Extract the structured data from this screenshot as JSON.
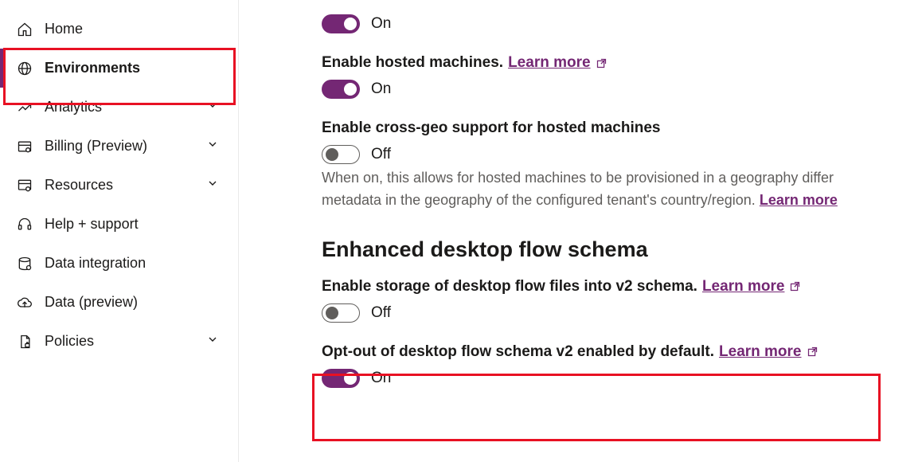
{
  "sidebar": {
    "items": [
      {
        "label": "Home"
      },
      {
        "label": "Environments"
      },
      {
        "label": "Analytics"
      },
      {
        "label": "Billing (Preview)"
      },
      {
        "label": "Resources"
      },
      {
        "label": "Help + support"
      },
      {
        "label": "Data integration"
      },
      {
        "label": "Data (preview)"
      },
      {
        "label": "Policies"
      }
    ]
  },
  "main": {
    "toggle_on": "On",
    "toggle_off": "Off",
    "learn_more": "Learn more",
    "setting0": {
      "state": "On"
    },
    "setting1": {
      "label": "Enable hosted machines.",
      "state": "On"
    },
    "setting2": {
      "label": "Enable cross-geo support for hosted machines",
      "state": "Off",
      "desc_part1": "When on, this allows for hosted machines to be provisioned in a geography differ",
      "desc_part2": "metadata in the geography of the configured tenant's country/region."
    },
    "section_title": "Enhanced desktop flow schema",
    "setting3": {
      "label": "Enable storage of desktop flow files into v2 schema.",
      "state": "Off"
    },
    "setting4": {
      "label": "Opt-out of desktop flow schema v2 enabled by default.",
      "state": "On"
    }
  }
}
